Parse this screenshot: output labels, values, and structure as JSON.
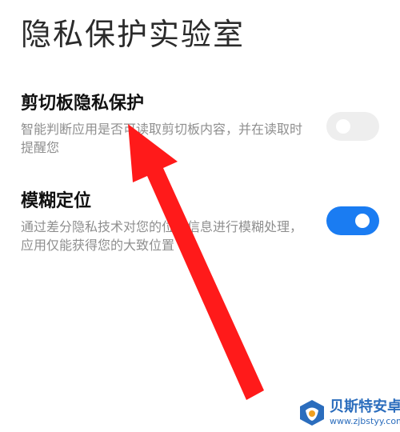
{
  "page": {
    "title": "隐私保护实验室"
  },
  "settings": [
    {
      "title": "剪切板隐私保护",
      "description": "智能判断应用是否可读取剪切板内容，并在读取时提醒您",
      "enabled": false
    },
    {
      "title": "模糊定位",
      "description": "通过差分隐私技术对您的位置信息进行模糊处理，应用仅能获得您的大致位置",
      "enabled": true
    }
  ],
  "colors": {
    "toggle_on": "#1a7cf2",
    "toggle_off": "#eeeeee",
    "arrow": "#ff1a1a",
    "watermark": "#2b6dbd"
  },
  "watermark": {
    "name": "贝斯特安卓网",
    "url": "www.zjbstyy.com"
  }
}
